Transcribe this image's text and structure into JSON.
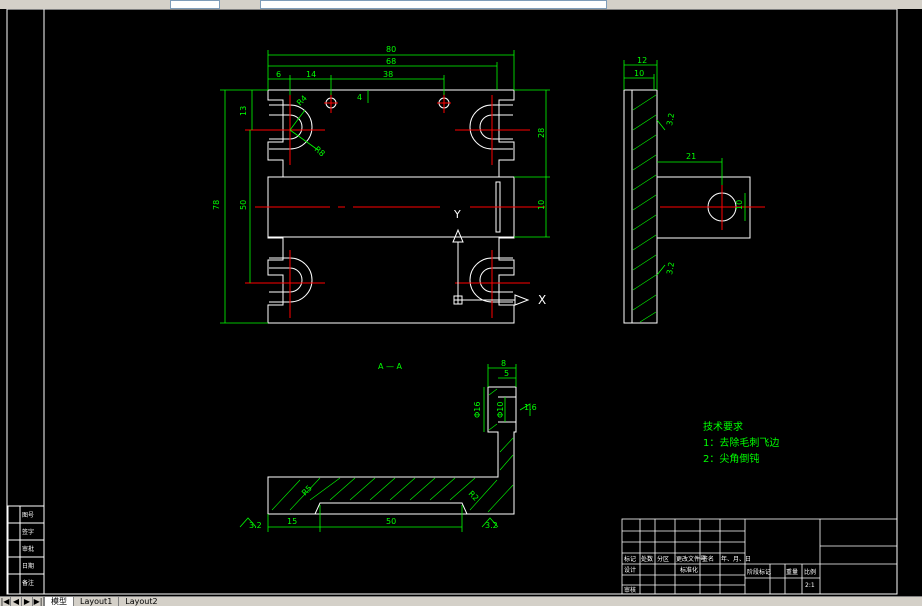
{
  "layout_tabs": {
    "nav": [
      "|◀",
      "◀",
      "▶",
      "▶|"
    ],
    "items": [
      "模型",
      "Layout1",
      "Layout2"
    ],
    "active_index": 0
  },
  "dims": {
    "top_view": {
      "overall_width": "80",
      "slot_span": "68",
      "d6": "6",
      "d14": "14",
      "d38": "38",
      "d4": "4",
      "d13": "13",
      "d28": "28",
      "overall_height": "78",
      "d50": "50",
      "d10": "10",
      "r_small": "R4",
      "r_large": "R8"
    },
    "side_view": {
      "d12": "12",
      "d10": "10",
      "d21": "21",
      "d10b": "10",
      "rough": "3.2"
    },
    "section": {
      "label": "A — A",
      "d8": "8",
      "d5": "5",
      "phi16": "Φ16",
      "phi10": "Φ10",
      "rough16": "1.6",
      "r15": "R5",
      "r12": "R2",
      "d15": "15",
      "d50": "50",
      "rough32a": "3.2",
      "rough32b": "3.2"
    },
    "axes": {
      "x": "X",
      "y": "Y"
    }
  },
  "tech_requirements": {
    "title": "技术要求",
    "items": [
      "1：去除毛刺飞边",
      "2：尖角倒钝"
    ]
  },
  "title_block": {
    "row1": [
      "标记",
      "处数",
      "分区",
      "更改文件号",
      "签名",
      "年、月、日"
    ],
    "row2": [
      "设计",
      "",
      "",
      "标准化"
    ],
    "row3": [
      "审核"
    ],
    "scale_labels": [
      "阶段标记",
      "重量",
      "比例"
    ],
    "scale": "2:1"
  },
  "left_block": {
    "rows": [
      "图号",
      "签字",
      "审批",
      "日期",
      "备注"
    ]
  },
  "colors": {
    "outline": "#ffffff",
    "dimension": "#00ff00",
    "center_line": "#ff0000",
    "background": "#000000"
  }
}
